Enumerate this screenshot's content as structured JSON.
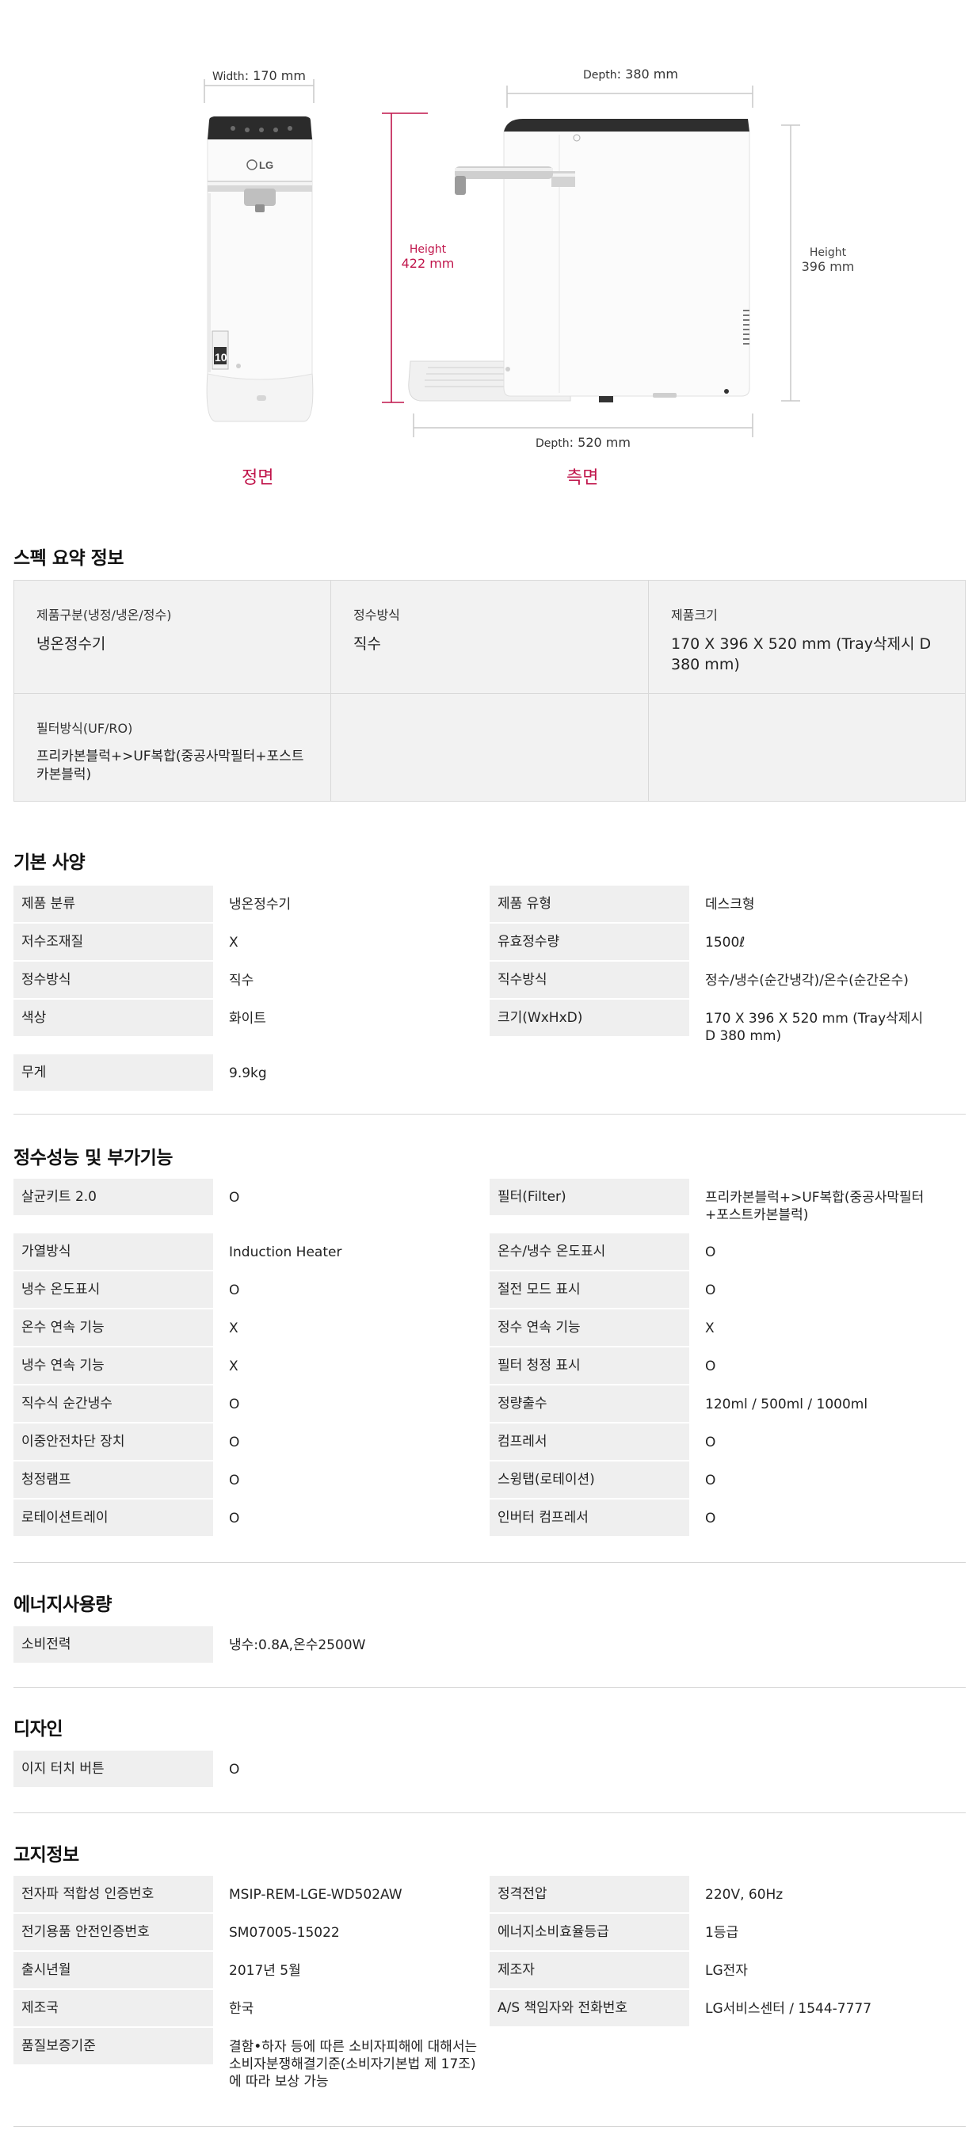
{
  "hero": {
    "front": {
      "width_label_key": "Width",
      "width_label_value": ": 170 mm",
      "view_label": "정면"
    },
    "side": {
      "depth_top_key": "Depth",
      "depth_top_value": ": 380 mm",
      "height_left_key": "Height",
      "height_left_value": "422 mm",
      "height_right_key": "Height",
      "height_right_value": "396 mm",
      "depth_bottom_key": "Depth",
      "depth_bottom_value": ": 520 mm",
      "view_label": "측면"
    },
    "brand_logo": "LG",
    "display_number": "10"
  },
  "summary": {
    "title": "스펙 요약 정보",
    "cells": [
      {
        "label": "제품구분(냉정/냉온/정수)",
        "value": "냉온정수기"
      },
      {
        "label": "정수방식",
        "value": "직수"
      },
      {
        "label": "제품크기",
        "value": "170 X 396 X 520 mm (Tray삭제시 D 380 mm)"
      },
      {
        "label": "필터방식(UF/RO)",
        "value": "프리카본블럭+>UF복합(중공사막필터+포스트카본블럭)"
      }
    ]
  },
  "basic": {
    "title": "기본 사양",
    "rows": [
      {
        "label": "제품 분류",
        "value": "냉온정수기"
      },
      {
        "label": "제품 유형",
        "value": "데스크형"
      },
      {
        "label": "저수조재질",
        "value": "X"
      },
      {
        "label": "유효정수량",
        "value": "1500ℓ"
      },
      {
        "label": "정수방식",
        "value": "직수"
      },
      {
        "label": "직수방식",
        "value": "정수/냉수(순간냉각)/온수(순간온수)"
      },
      {
        "label": "색상",
        "value": "화이트"
      },
      {
        "label": "크기(WxHxD)",
        "value": "170 X 396 X 520 mm (Tray삭제시 D 380 mm)"
      },
      {
        "label": "무게",
        "value": "9.9kg"
      }
    ]
  },
  "performance": {
    "title": "정수성능 및 부가기능",
    "rows": [
      {
        "label": "살균키트 2.0",
        "value": "O"
      },
      {
        "label": "필터(Filter)",
        "value": "프리카본블럭+>UF복합(중공사막필터+포스트카본블럭)"
      },
      {
        "label": "가열방식",
        "value": "Induction Heater"
      },
      {
        "label": "온수/냉수 온도표시",
        "value": "O"
      },
      {
        "label": "냉수 온도표시",
        "value": "O"
      },
      {
        "label": "절전 모드 표시",
        "value": "O"
      },
      {
        "label": "온수 연속 기능",
        "value": "X"
      },
      {
        "label": "정수 연속 기능",
        "value": "X"
      },
      {
        "label": "냉수 연속 기능",
        "value": "X"
      },
      {
        "label": "필터 청정 표시",
        "value": "O"
      },
      {
        "label": "직수식 순간냉수",
        "value": "O"
      },
      {
        "label": "정량출수",
        "value": "120ml / 500ml / 1000ml"
      },
      {
        "label": "이중안전차단 장치",
        "value": "O"
      },
      {
        "label": "컴프레서",
        "value": "O"
      },
      {
        "label": "청정램프",
        "value": "O"
      },
      {
        "label": "스윙탭(로테이션)",
        "value": "O"
      },
      {
        "label": "로테이션트레이",
        "value": "O"
      },
      {
        "label": "인버터 컴프레서",
        "value": "O"
      }
    ]
  },
  "energy": {
    "title": "에너지사용량",
    "rows": [
      {
        "label": "소비전력",
        "value": "냉수:0.8A,온수2500W"
      }
    ]
  },
  "design": {
    "title": "디자인",
    "rows": [
      {
        "label": "이지 터치 버튼",
        "value": "O"
      }
    ]
  },
  "notice": {
    "title": "고지정보",
    "rows": [
      {
        "label": "전자파 적합성 인증번호",
        "value": "MSIP-REM-LGE-WD502AW"
      },
      {
        "label": "정격전압",
        "value": "220V, 60Hz"
      },
      {
        "label": "전기용품 안전인증번호",
        "value": "SM07005-15022"
      },
      {
        "label": "에너지소비효율등급",
        "value": "1등급"
      },
      {
        "label": "출시년월",
        "value": "2017년 5월"
      },
      {
        "label": "제조자",
        "value": "LG전자"
      },
      {
        "label": "제조국",
        "value": "한국"
      },
      {
        "label": "A/S 책임자와 전화번호",
        "value": "LG서비스센터 / 1544-7777"
      },
      {
        "label": "품질보증기준",
        "value": "결함•하자 등에 따른 소비자피해에 대해서는 소비자분쟁해결기준(소비자기본법 제 17조)에 따라 보상 가능"
      }
    ]
  }
}
